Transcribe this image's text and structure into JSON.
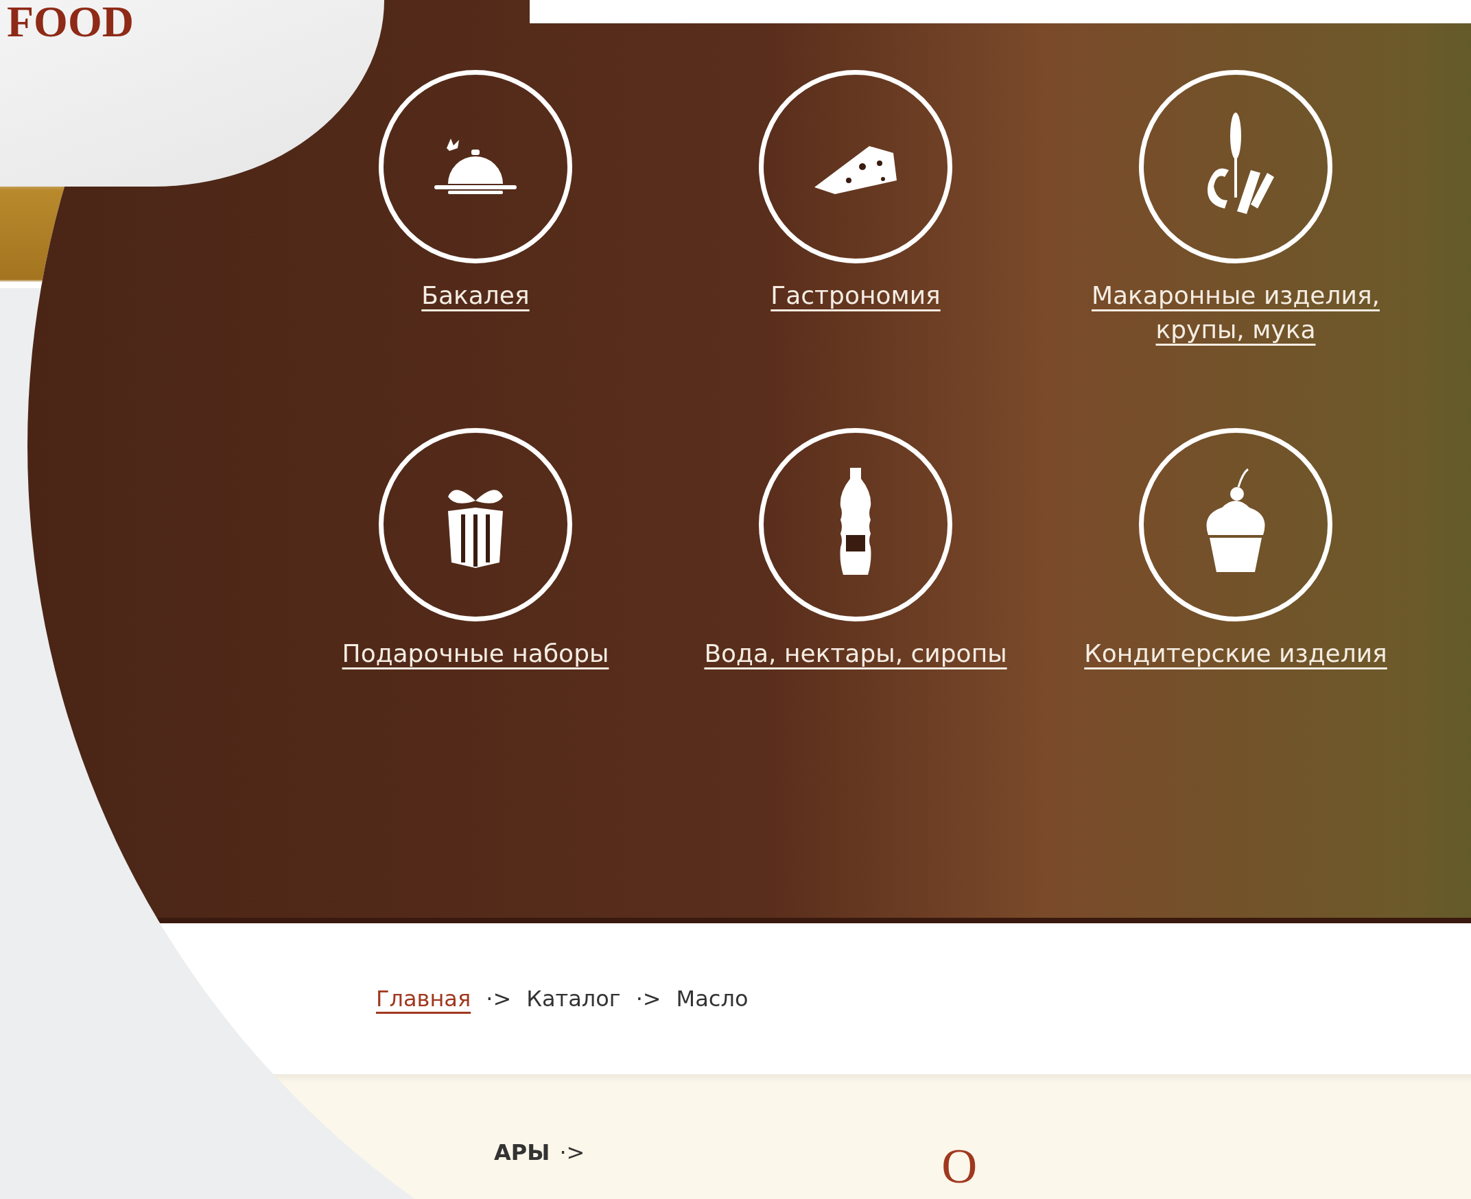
{
  "logo": {
    "text": "FOOD"
  },
  "categories": [
    {
      "label": "Бакалея"
    },
    {
      "label": "Гастрономия"
    },
    {
      "label": "Макаронные изделия, крупы, мука"
    },
    {
      "label": "Подарочные наборы"
    },
    {
      "label": "Вода, нектары, сиропы"
    },
    {
      "label": "Кондитерские изделия"
    }
  ],
  "breadcrumb": [
    {
      "kind": "link",
      "label": "Главная"
    },
    {
      "kind": "separator",
      "label": "·>"
    },
    {
      "kind": "text",
      "label": "Каталог"
    },
    {
      "kind": "separator",
      "label": "·>"
    },
    {
      "kind": "text",
      "label": "Масло"
    }
  ],
  "sidebar": {
    "heading": "АРЫ",
    "arrow": "·>"
  },
  "page_title": "О"
}
